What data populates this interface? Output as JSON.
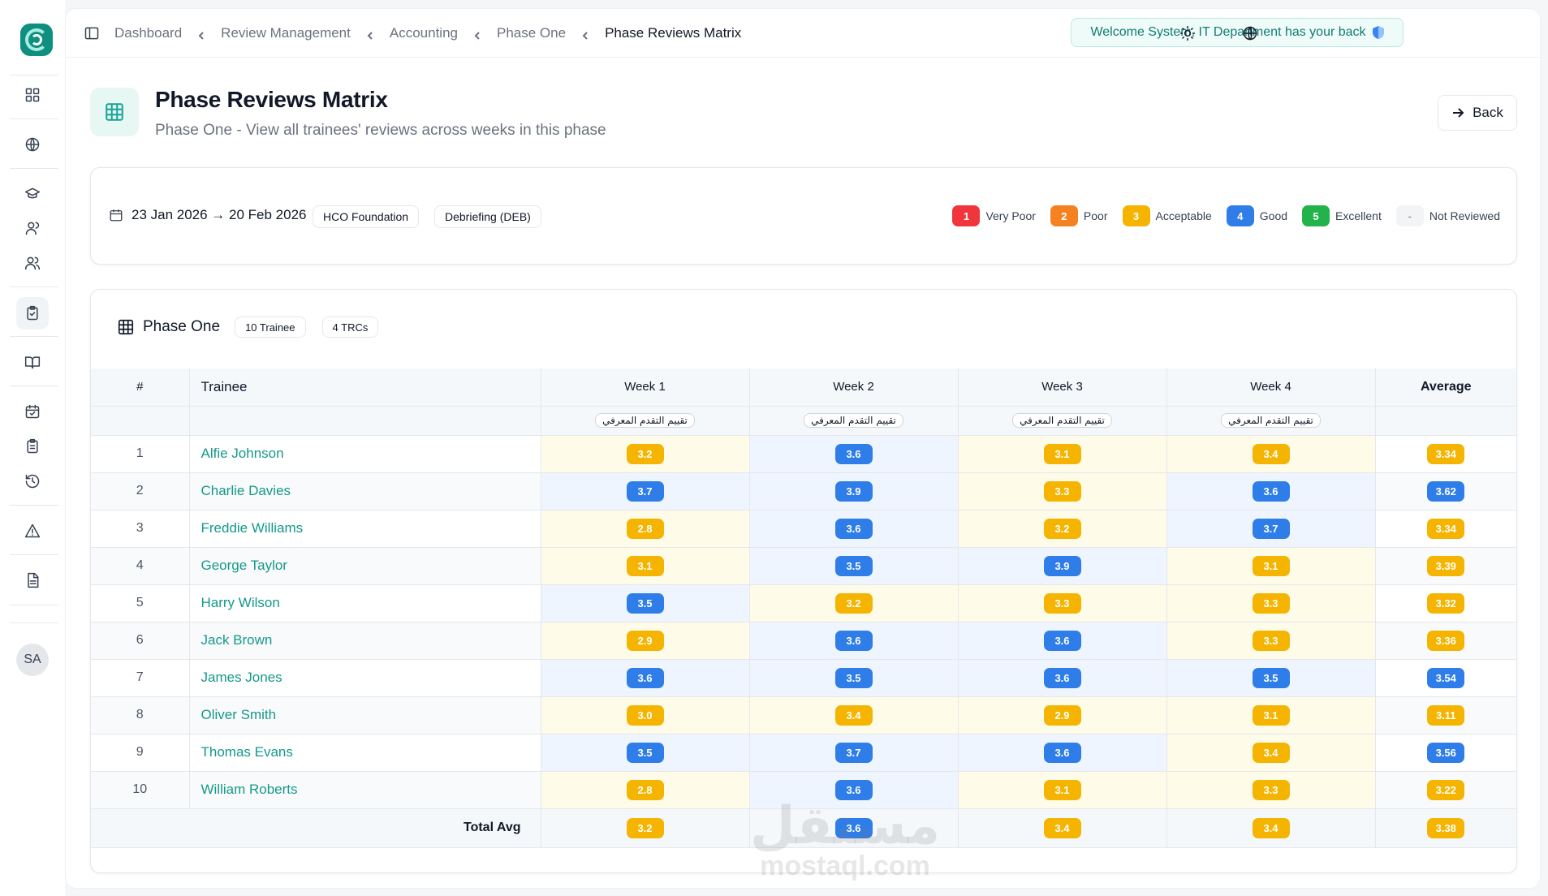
{
  "sidebar": {
    "icons": [
      "grid-icon",
      "globe-brain-icon",
      "graduation-cap-icon",
      "user-icon",
      "users-icon",
      "clipboard-check-icon",
      "book-open-icon",
      "calendar-check-icon",
      "clipboard-list-icon",
      "history-icon",
      "alert-triangle-icon",
      "file-text-icon"
    ],
    "avatar": "SA"
  },
  "breadcrumb": {
    "items": [
      "Dashboard",
      "Review Management",
      "Accounting",
      "Phase One",
      "Phase Reviews Matrix"
    ]
  },
  "welcome": "Welcome System, IT Department has your back",
  "header": {
    "title": "Phase Reviews Matrix",
    "subtitle": "Phase One - View all trainees' reviews across weeks in this phase",
    "back_label": "Back"
  },
  "filters": {
    "date_range": "23 Jan 2026 → 20 Feb 2026",
    "tags": [
      "HCO Foundation",
      "Debriefing (DEB)"
    ]
  },
  "legend": [
    {
      "value": "1",
      "label": "Very Poor",
      "color": "#f0353d"
    },
    {
      "value": "2",
      "label": "Poor",
      "color": "#f58220"
    },
    {
      "value": "3",
      "label": "Acceptable",
      "color": "#f4b400"
    },
    {
      "value": "4",
      "label": "Good",
      "color": "#2f7de9"
    },
    {
      "value": "5",
      "label": "Excellent",
      "color": "#22b34a"
    },
    {
      "value": "-",
      "label": "Not Reviewed",
      "color": "#f3f4f6"
    }
  ],
  "matrix": {
    "title": "Phase One",
    "trainee_count": "10 Trainee",
    "trc_count": "4 TRCs",
    "col_index": "#",
    "col_trainee": "Trainee",
    "weeks": [
      "Week 1",
      "Week 2",
      "Week 3",
      "Week 4"
    ],
    "col_average": "Average",
    "sub_label": "تقييم التقدم المعرفي",
    "rows": [
      {
        "idx": "1",
        "name": "Alfie Johnson",
        "scores": [
          "3.2",
          "3.6",
          "3.1",
          "3.4"
        ],
        "avg": "3.34"
      },
      {
        "idx": "2",
        "name": "Charlie Davies",
        "scores": [
          "3.7",
          "3.9",
          "3.3",
          "3.6"
        ],
        "avg": "3.62"
      },
      {
        "idx": "3",
        "name": "Freddie Williams",
        "scores": [
          "2.8",
          "3.6",
          "3.2",
          "3.7"
        ],
        "avg": "3.34"
      },
      {
        "idx": "4",
        "name": "George Taylor",
        "scores": [
          "3.1",
          "3.5",
          "3.9",
          "3.1"
        ],
        "avg": "3.39"
      },
      {
        "idx": "5",
        "name": "Harry Wilson",
        "scores": [
          "3.5",
          "3.2",
          "3.3",
          "3.3"
        ],
        "avg": "3.32"
      },
      {
        "idx": "6",
        "name": "Jack Brown",
        "scores": [
          "2.9",
          "3.6",
          "3.6",
          "3.3"
        ],
        "avg": "3.36"
      },
      {
        "idx": "7",
        "name": "James Jones",
        "scores": [
          "3.6",
          "3.5",
          "3.6",
          "3.5"
        ],
        "avg": "3.54"
      },
      {
        "idx": "8",
        "name": "Oliver Smith",
        "scores": [
          "3.0",
          "3.4",
          "2.9",
          "3.1"
        ],
        "avg": "3.11"
      },
      {
        "idx": "9",
        "name": "Thomas Evans",
        "scores": [
          "3.5",
          "3.7",
          "3.6",
          "3.4"
        ],
        "avg": "3.56"
      },
      {
        "idx": "10",
        "name": "William Roberts",
        "scores": [
          "2.8",
          "3.6",
          "3.1",
          "3.3"
        ],
        "avg": "3.22"
      }
    ],
    "total_label": "Total Avg",
    "totals": [
      "3.2",
      "3.6",
      "3.4",
      "3.4"
    ],
    "total_avg": "3.38"
  },
  "colors": {
    "accent": "#14a394",
    "acceptable": "#f4b400",
    "good": "#2f7de9"
  },
  "watermark": {
    "ar": "مستقل",
    "en": "mostaql.com"
  }
}
